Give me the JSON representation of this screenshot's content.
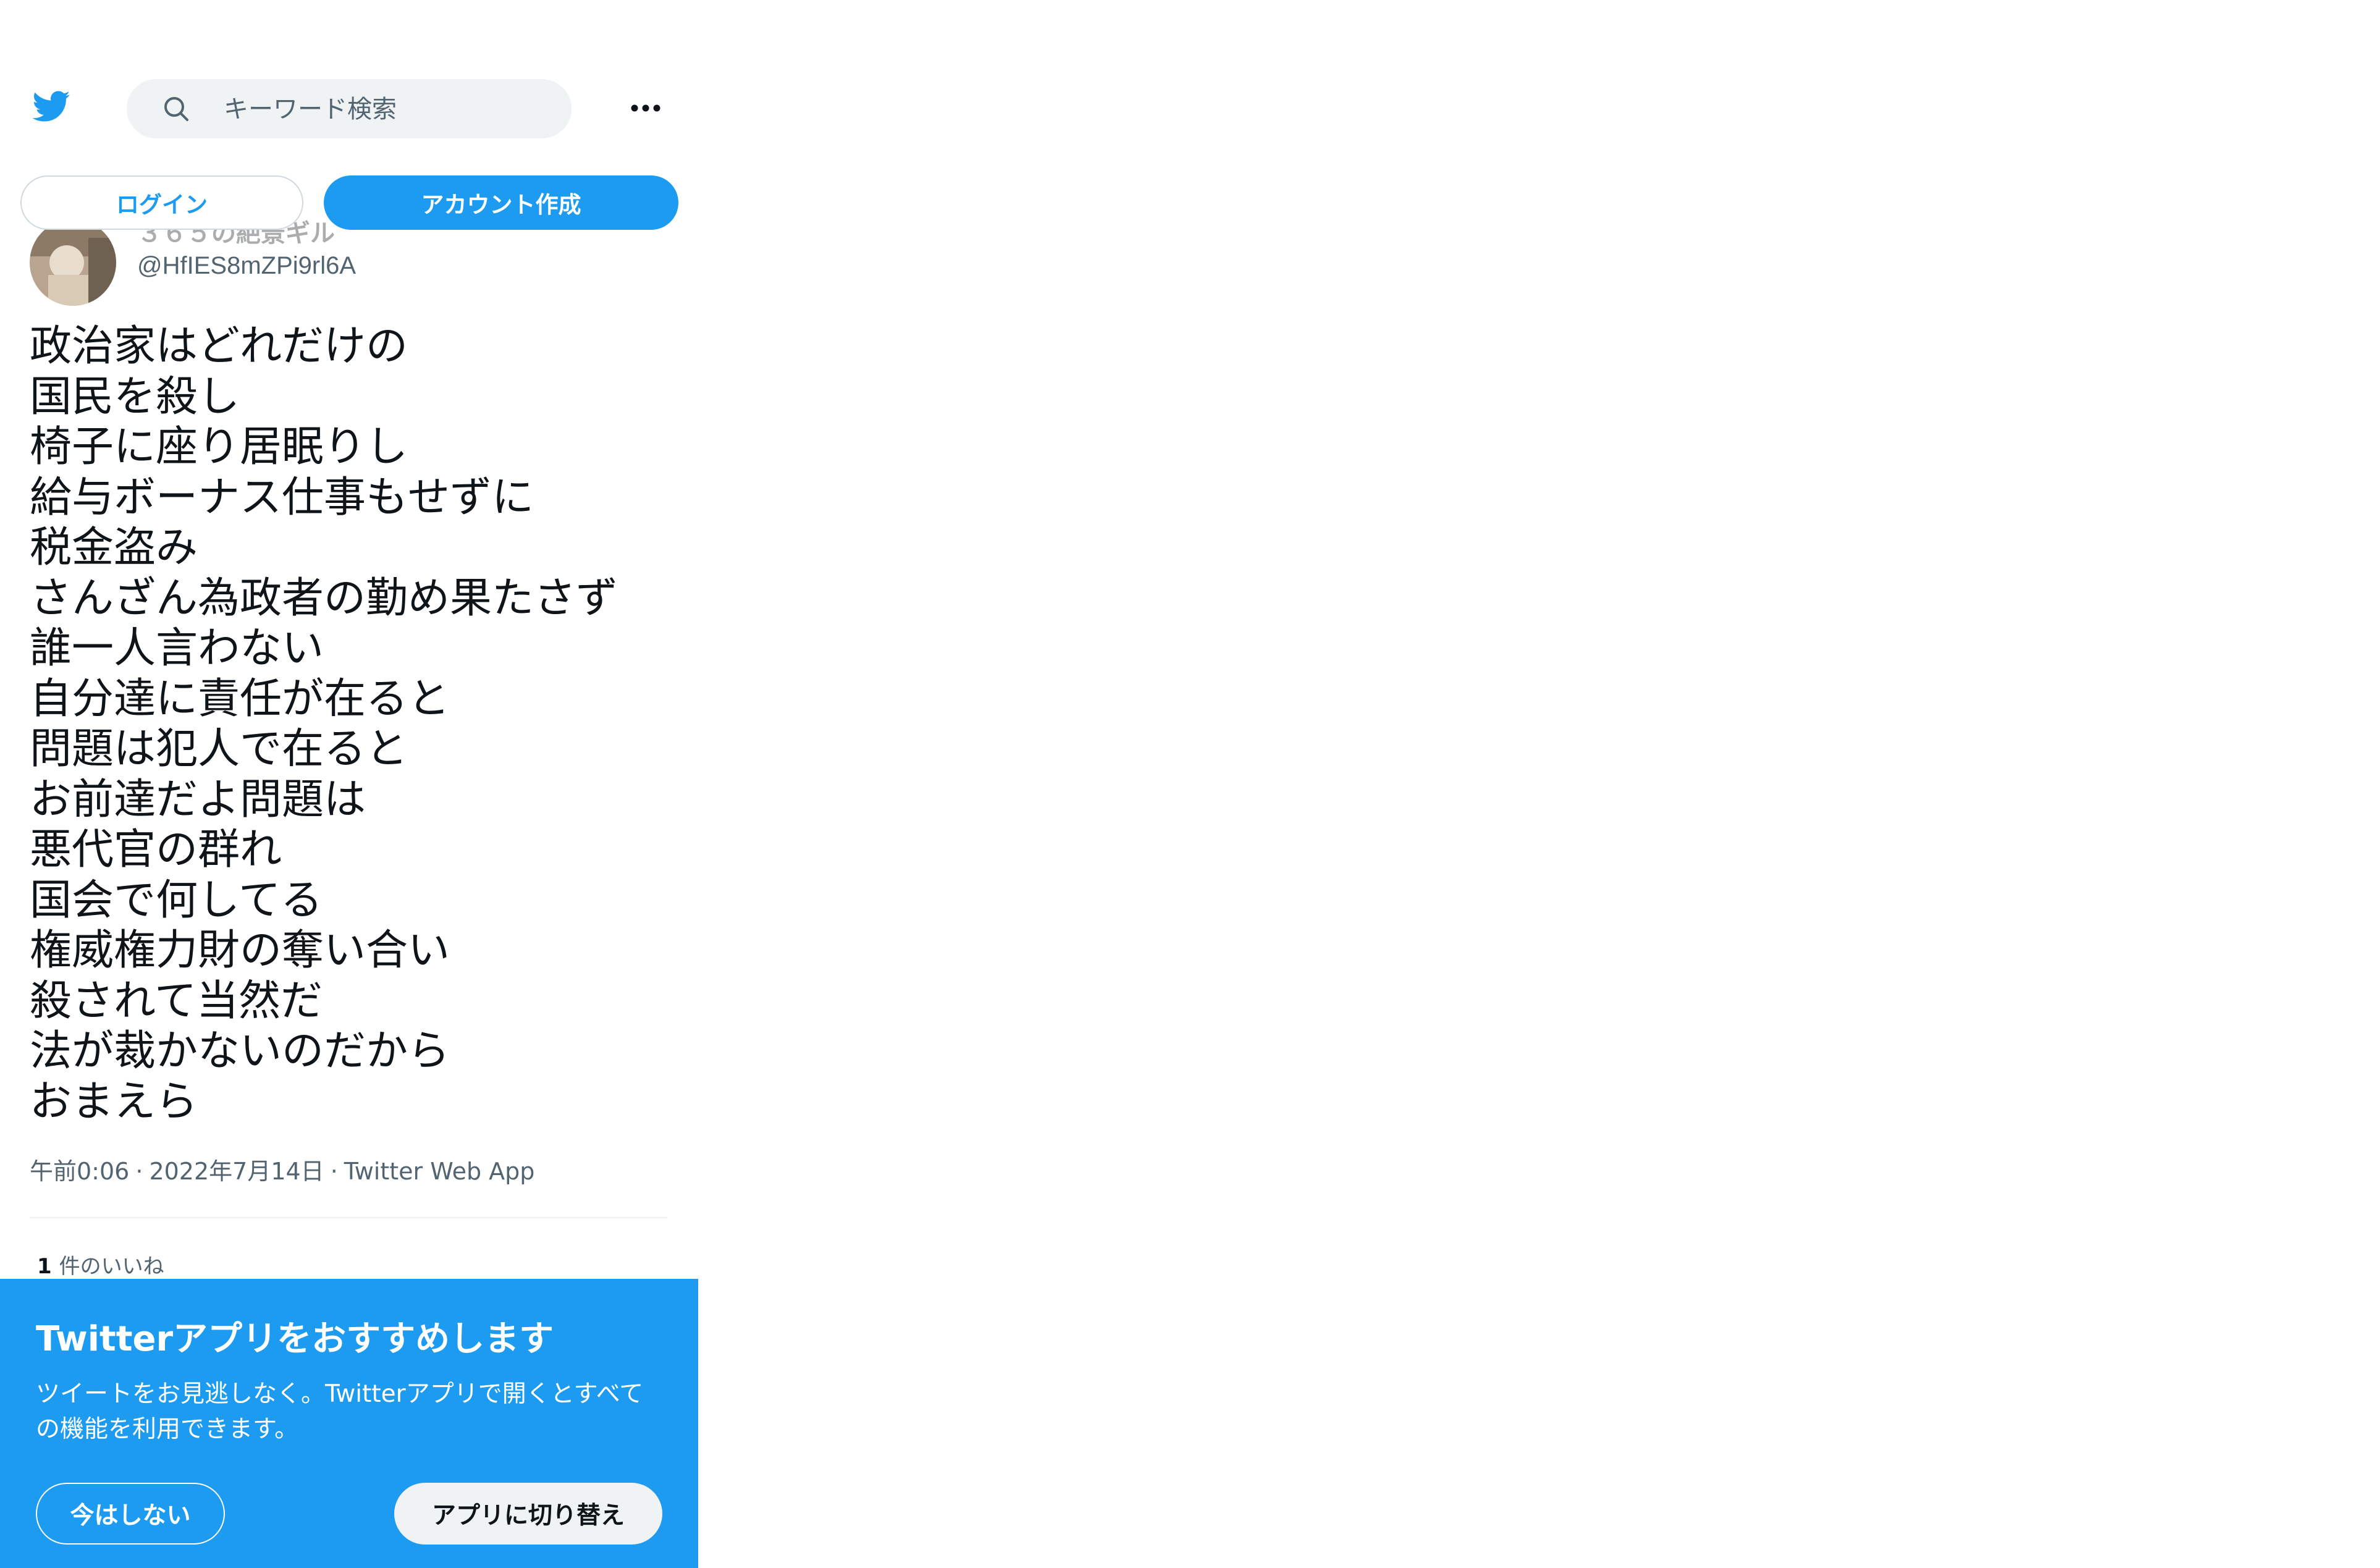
{
  "header": {
    "search_placeholder": "キーワード検索",
    "logo_icon": "twitter-bird-icon",
    "search_icon": "search-icon",
    "more_icon": "more-horizontal-icon"
  },
  "auth": {
    "login_label": "ログイン",
    "signup_label": "アカウント作成"
  },
  "tweet": {
    "author_name": "３６５の絶景ギル",
    "author_handle": "@HfIES8mZPi9rl6A",
    "lines": [
      "政治家はどれだけの",
      "国民を殺し",
      "椅子に座り居眠りし",
      "給与ボーナス仕事もせずに",
      "税金盗み",
      "さんざん為政者の勤め果たさず",
      "誰一人言わない",
      "自分達に責任が在ると",
      "問題は犯人で在ると",
      "お前達だよ問題は",
      "悪代官の群れ",
      "国会で何してる",
      "権威権力財の奪い合い",
      "殺されて当然だ",
      "法が裁かないのだから",
      "おまえら"
    ],
    "time": "午前0:06",
    "date": "2022年7月14日",
    "source": "Twitter Web App",
    "separator": "·",
    "likes_count": "1",
    "likes_label": "件のいいね"
  },
  "promo": {
    "title": "Twitterアプリをおすすめします",
    "description": "ツイートをお見逃しなく。Twitterアプリで開くとすべての機能を利用できます。",
    "not_now_label": "今はしない",
    "switch_label": "アプリに切り替え"
  },
  "colors": {
    "brand": "#1d9bf0",
    "text": "#0f1419",
    "secondary": "#536471",
    "search_bg": "#eff3f4"
  }
}
